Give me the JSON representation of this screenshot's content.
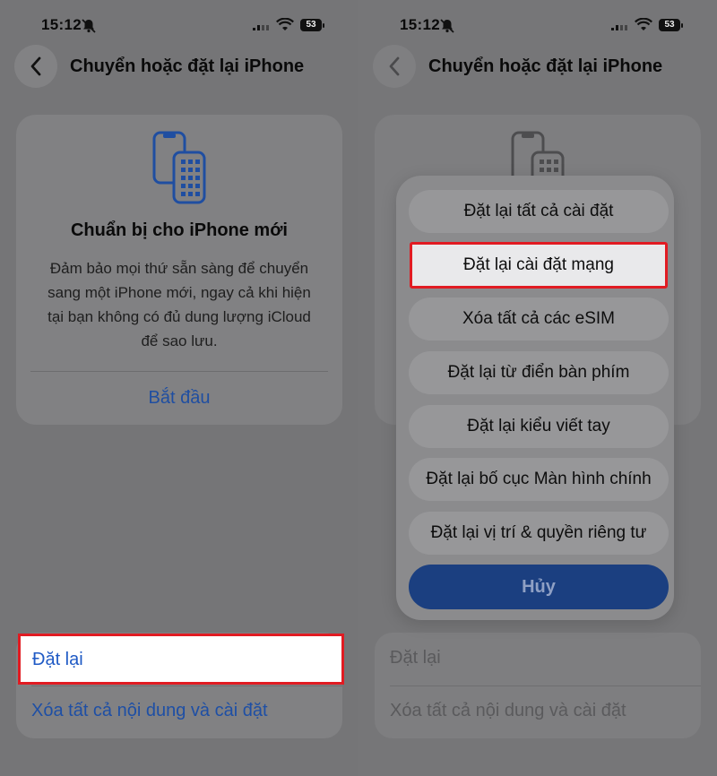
{
  "status": {
    "time": "15:12",
    "battery": "53"
  },
  "nav": {
    "title": "Chuyển hoặc đặt lại iPhone"
  },
  "card": {
    "title": "Chuẩn bị cho iPhone mới",
    "description": "Đảm bảo mọi thứ sẵn sàng để chuyển sang một iPhone mới, ngay cả khi hiện tại bạn không có đủ dung lượng iCloud để sao lưu.",
    "action": "Bắt đầu"
  },
  "list": {
    "reset": "Đặt lại",
    "erase_all": "Xóa tất cả nội dung và cài đặt"
  },
  "sheet": {
    "options": [
      "Đặt lại tất cả cài đặt",
      "Đặt lại cài đặt mạng",
      "Xóa tất cả các eSIM",
      "Đặt lại từ điển bàn phím",
      "Đặt lại kiểu viết tay",
      "Đặt lại bố cục Màn hình chính",
      "Đặt lại vị trí & quyền riêng tư"
    ],
    "cancel": "Hủy"
  }
}
